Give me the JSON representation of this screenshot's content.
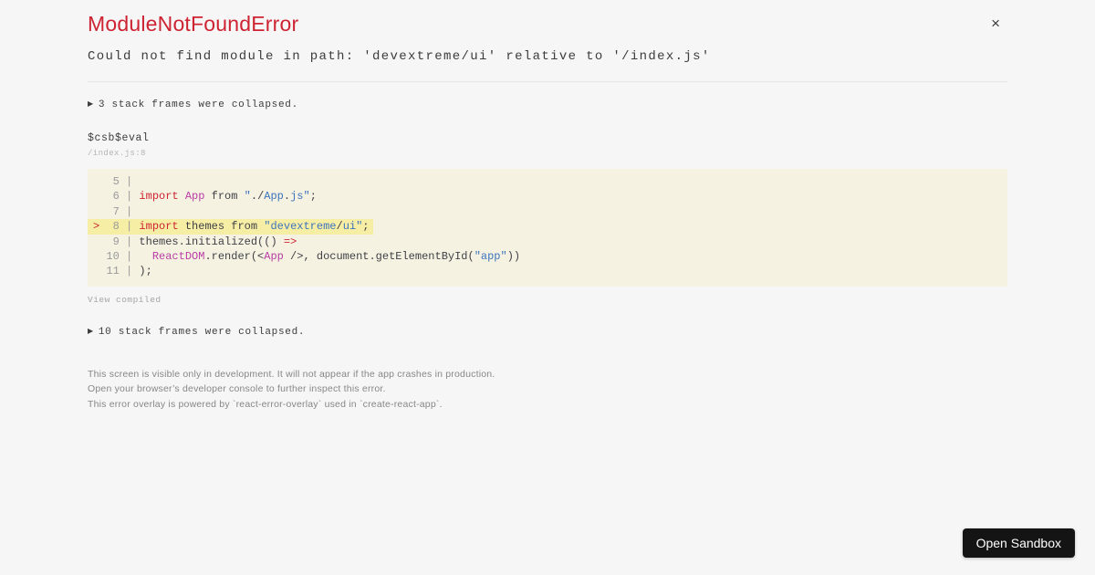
{
  "colors": {
    "page_bg": "#f6f6f6",
    "accent_red": "#cd2332",
    "ident_magenta": "#b93da6",
    "string_blue": "#3d73bd",
    "gutter_gray": "#9a9a9a",
    "code_bg": "#f6f2e2",
    "code_highlight_bg": "#f7eea6",
    "button_bg": "#141414",
    "footer_gray": "#878787"
  },
  "header": {
    "title": "ModuleNotFoundError",
    "close_glyph": "×"
  },
  "message": "Could not find module in path: 'devextreme/ui' relative to '/index.js'",
  "stack_top": {
    "arrow_glyph": "▶",
    "label": "3 stack frames were collapsed."
  },
  "frame": {
    "function_name": "$csb$eval",
    "location": "/index.js:8"
  },
  "code": {
    "highlighted_line": 8,
    "lines": [
      {
        "hl": false,
        "tokens": [
          [
            "g",
            "   5 | "
          ]
        ]
      },
      {
        "hl": false,
        "tokens": [
          [
            "g",
            "   6 | "
          ],
          [
            "k",
            "import"
          ],
          [
            "p",
            " "
          ],
          [
            "i",
            "App"
          ],
          [
            "p",
            " from "
          ],
          [
            "s",
            "\""
          ],
          [
            "p",
            "./"
          ],
          [
            "s",
            "App"
          ],
          [
            "p",
            "."
          ],
          [
            "s",
            "js\""
          ],
          [
            "p",
            ";"
          ]
        ]
      },
      {
        "hl": false,
        "tokens": [
          [
            "g",
            "   7 | "
          ]
        ]
      },
      {
        "hl": true,
        "tokens": [
          [
            "m",
            "> "
          ],
          [
            "g",
            " 8 | "
          ],
          [
            "k",
            "import"
          ],
          [
            "p",
            " themes from "
          ],
          [
            "s",
            "\"devextreme"
          ],
          [
            "p",
            "/"
          ],
          [
            "s",
            "ui\""
          ],
          [
            "p",
            ";"
          ]
        ]
      },
      {
        "hl": false,
        "tokens": [
          [
            "g",
            "   9 | "
          ],
          [
            "p",
            "themes.initialized(() "
          ],
          [
            "k",
            "=>"
          ]
        ]
      },
      {
        "hl": false,
        "tokens": [
          [
            "g",
            "  10 | "
          ],
          [
            "p",
            "  "
          ],
          [
            "i",
            "ReactDOM"
          ],
          [
            "p",
            ".render(<"
          ],
          [
            "i",
            "App"
          ],
          [
            "p",
            " />, document.getElementById("
          ],
          [
            "s",
            "\"app\""
          ],
          [
            "p",
            "))"
          ]
        ]
      },
      {
        "hl": false,
        "tokens": [
          [
            "g",
            "  11 | "
          ],
          [
            "p",
            ");"
          ]
        ]
      }
    ]
  },
  "view_compiled": "View compiled",
  "stack_bottom": {
    "arrow_glyph": "▶",
    "label": "10 stack frames were collapsed."
  },
  "footer": {
    "lines": [
      "This screen is visible only in development. It will not appear if the app crashes in production.",
      "Open your browser’s developer console to further inspect this error.",
      "This error overlay is powered by `react-error-overlay` used in `create-react-app`."
    ]
  },
  "open_sandbox_label": "Open Sandbox"
}
